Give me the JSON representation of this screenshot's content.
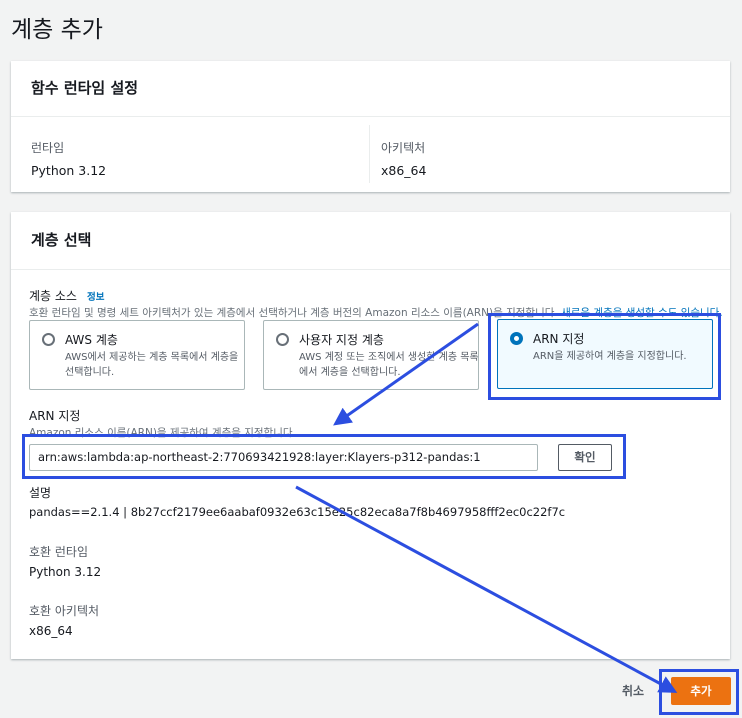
{
  "page": {
    "title": "계층 추가"
  },
  "runtime_settings": {
    "heading": "함수 런타임 설정",
    "runtime_label": "런타임",
    "runtime_value": "Python 3.12",
    "arch_label": "아키텍처",
    "arch_value": "x86_64"
  },
  "layer_select": {
    "heading": "계층 선택",
    "source_label": "계층 소스",
    "info_link": "정보",
    "source_desc": "호환 런타임 및 명령 세트 아키텍처가 있는 계층에서 선택하거나 계층 버전의 Amazon 리소스 이름(ARN)을 지정합니다.",
    "create_link": "새로운 계층을 생성할 수도 있습니다.",
    "options": [
      {
        "title": "AWS 계층",
        "desc": "AWS에서 제공하는 계층 목록에서 계층을 선택합니다.",
        "selected": false
      },
      {
        "title": "사용자 지정 계층",
        "desc": "AWS 계정 또는 조직에서 생성한 계층 목록에서 계층을 선택합니다.",
        "selected": false
      },
      {
        "title": "ARN 지정",
        "desc": "ARN을 제공하여 계층을 지정합니다.",
        "selected": true
      }
    ],
    "arn_label": "ARN 지정",
    "arn_desc": "Amazon 리소스 이름(ARN)을 제공하여 계층을 지정합니다.",
    "arn_value": "arn:aws:lambda:ap-northeast-2:770693421928:layer:Klayers-p312-pandas:1",
    "confirm_button": "확인",
    "description_label": "설명",
    "description_value": "pandas==2.1.4 | 8b27ccf2179ee6aabaf0932e63c15e25c82eca8a7f8b4697958fff2ec0c22f7c",
    "compat_runtime_label": "호환 런타임",
    "compat_runtime_value": "Python 3.12",
    "compat_arch_label": "호환 아키텍처",
    "compat_arch_value": "x86_64"
  },
  "footer": {
    "cancel_button": "취소",
    "add_button": "추가"
  },
  "colors": {
    "accent": "#0073bb",
    "primary_button": "#ec7211",
    "highlight": "#2c4ee0"
  }
}
